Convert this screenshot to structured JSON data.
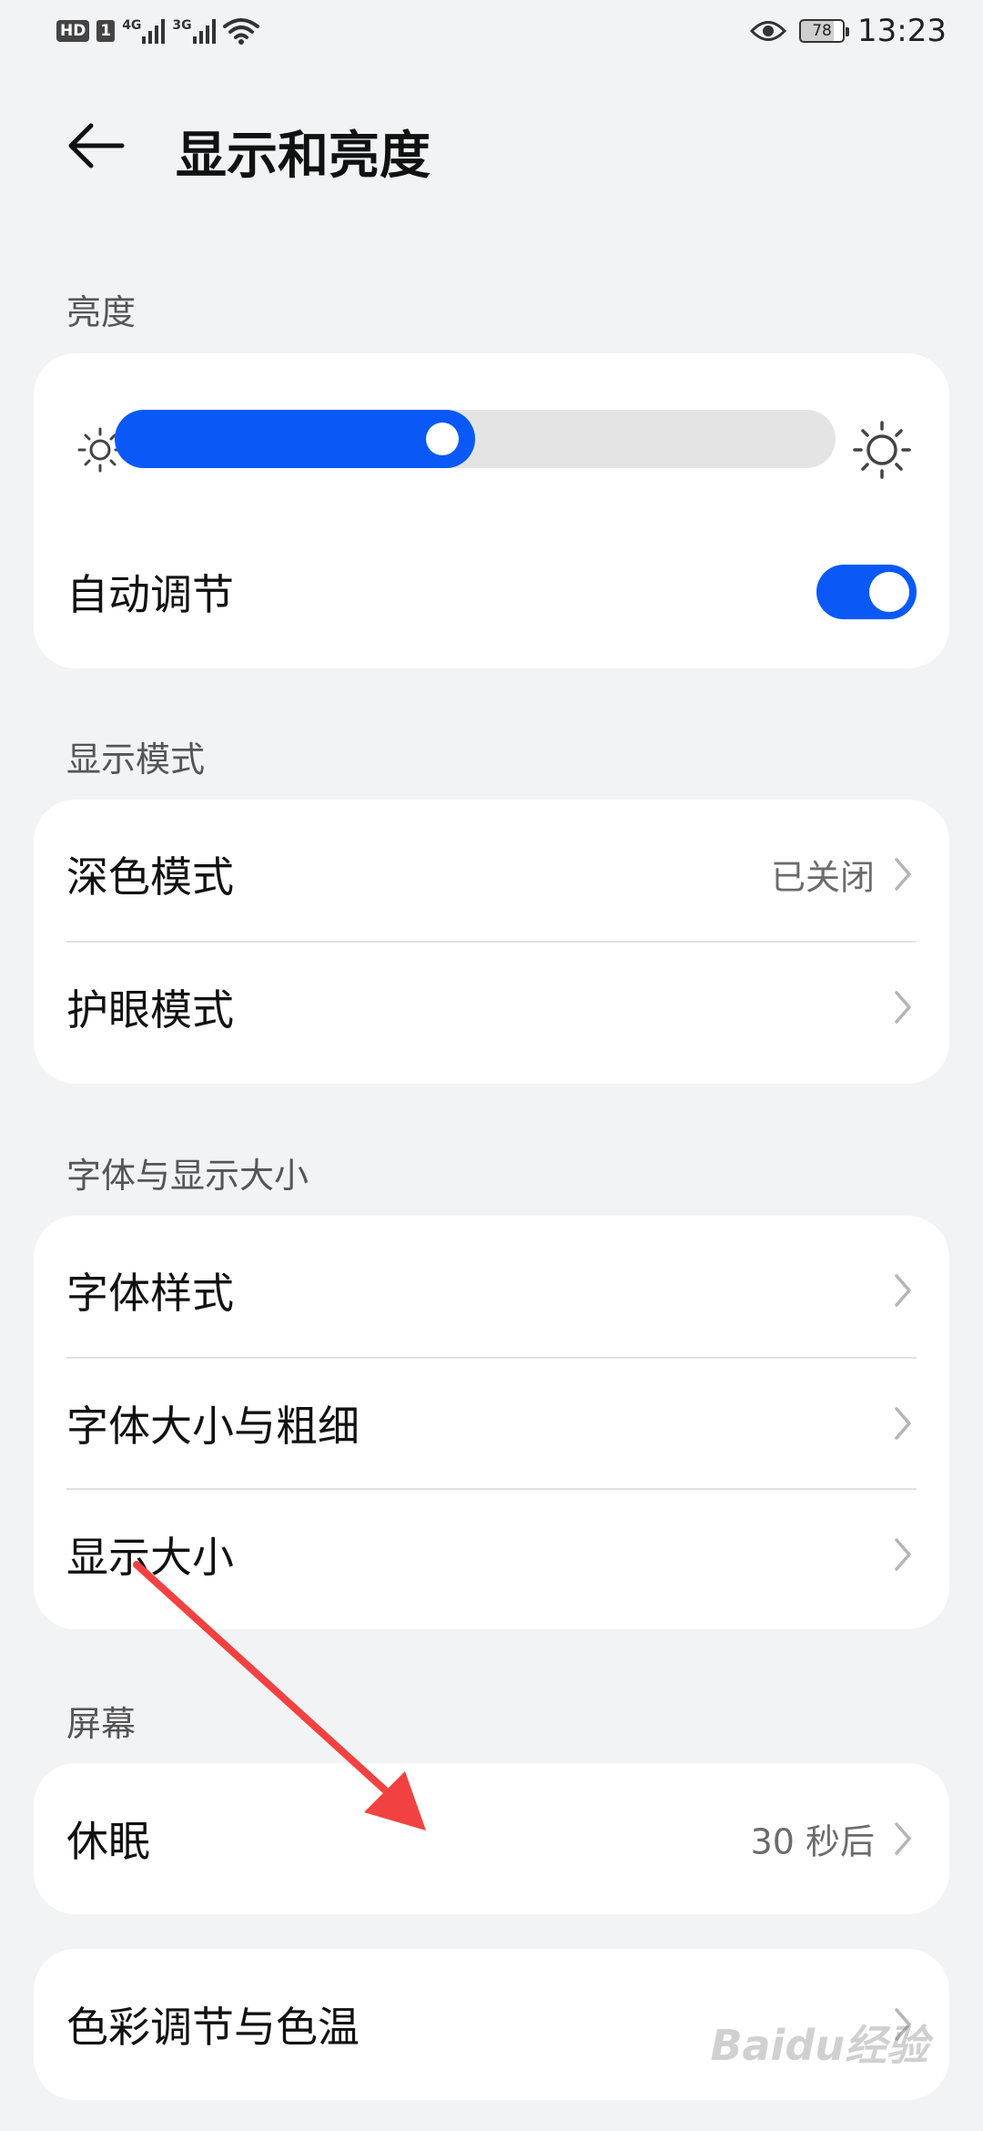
{
  "status_bar": {
    "hd": "HD",
    "sim": "1",
    "net1": "4G",
    "net2": "3G",
    "battery": "78",
    "time": "13:23"
  },
  "header": {
    "title": "显示和亮度",
    "back_icon": "arrow-left-icon"
  },
  "brightness": {
    "section_label": "亮度",
    "level": 0.5,
    "auto_adjust_label": "自动调节",
    "auto_adjust_on": true
  },
  "display_mode": {
    "section_label": "显示模式",
    "items": [
      {
        "label": "深色模式",
        "value": "已关闭"
      },
      {
        "label": "护眼模式",
        "value": ""
      }
    ]
  },
  "font_display": {
    "section_label": "字体与显示大小",
    "items": [
      {
        "label": "字体样式"
      },
      {
        "label": "字体大小与粗细"
      },
      {
        "label": "显示大小"
      }
    ]
  },
  "screen": {
    "section_label": "屏幕",
    "sleep_label": "休眠",
    "sleep_value": "30 秒后",
    "color_label": "色彩调节与色温"
  },
  "colors": {
    "accent": "#0a59f7",
    "background": "#f1f3f5",
    "annotation_arrow": "#f24141"
  },
  "watermark": "Baidu经验"
}
